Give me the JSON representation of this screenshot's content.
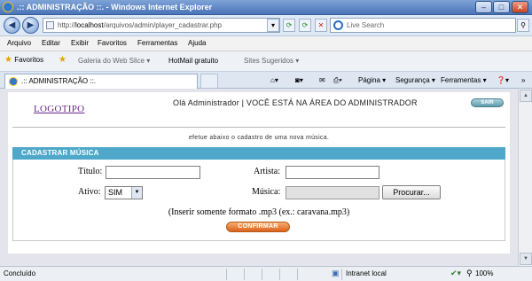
{
  "window": {
    "title": ".:: ADMINISTRAÇÃO ::. - Windows Internet Explorer",
    "min_glyph": "–",
    "max_glyph": "□",
    "close_glyph": "✕"
  },
  "nav": {
    "back_glyph": "◀",
    "forward_glyph": "▶",
    "url_prefix": "http://",
    "url_host": "localhost",
    "url_path": "/arquivos/admin/player_cadastrar.php",
    "dropdown_glyph": "▾",
    "refresh_glyph": "⟳",
    "stop_glyph": "✕",
    "search_placeholder": "Live Search",
    "search_glyph": "⚲"
  },
  "menu": {
    "items": [
      "Arquivo",
      "Editar",
      "Exibir",
      "Favoritos",
      "Ferramentas",
      "Ajuda"
    ]
  },
  "favorites": {
    "label": "Favoritos",
    "items": [
      "Galeria do Web Slice ▾",
      "HotMail gratuito",
      "Sites Sugeridos ▾"
    ]
  },
  "tabs": {
    "active_label": ".:: ADMINISTRAÇÃO ::."
  },
  "commandbar": {
    "pagina": "Página ▾",
    "seguranca": "Segurança ▾",
    "ferramentas": "Ferramentas ▾",
    "help": "❓▾",
    "chevron": "»"
  },
  "page": {
    "logo": "LOGOTIPO",
    "greeting": "Olá Administrador   |   VOCÊ ESTÁ NA ÁREA DO ADMINISTRADOR",
    "logout_label": "SAIR",
    "instructions": "efetue abaixo o cadastro de uma nova música.",
    "section_title": "CADASTRAR MÚSICA",
    "form": {
      "titulo_label": "Título:",
      "titulo_value": "",
      "artista_label": "Artista:",
      "artista_value": "",
      "ativo_label": "Ativo:",
      "ativo_selected": "SIM",
      "musica_label": "Música:",
      "browse_label": "Procurar...",
      "hint": "(Inserir somente formato .mp3 (ex.: caravana.mp3)",
      "confirm_label": "CONFIRMAR"
    }
  },
  "statusbar": {
    "status": "Concluído",
    "zone": "Intranet local",
    "zoom": "100%"
  },
  "colors": {
    "section_bar": "#4fa8c9",
    "logo": "#6a2a8a",
    "confirm_button": "#d9621c",
    "logout_button": "#5f9aaa"
  }
}
